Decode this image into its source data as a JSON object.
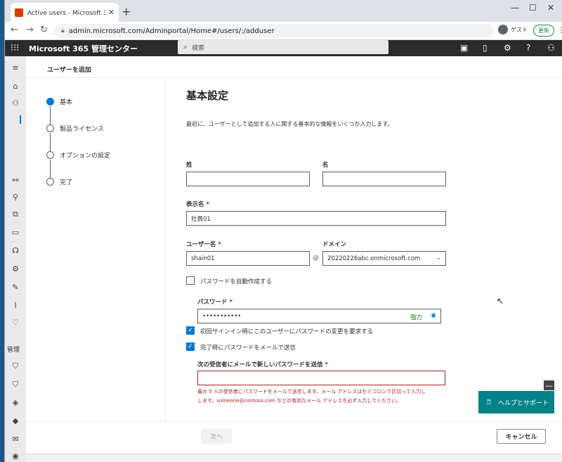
{
  "browser": {
    "tab_title": "Active users - Microsoft 365 管理",
    "new_tab": "+",
    "minimize": "—",
    "maximize": "☐",
    "close": "✕",
    "url": "admin.microsoft.com/Adminportal/Home#/users/:/adduser",
    "guest_label": "ゲスト",
    "update_label": "更新"
  },
  "header": {
    "brand": "Microsoft 365 管理センター",
    "search_placeholder": "検索"
  },
  "rail": {
    "section_label": "管理"
  },
  "panel": {
    "title": "ユーザーを追加"
  },
  "steps": [
    {
      "label": "基本",
      "active": true
    },
    {
      "label": "製品ライセンス",
      "active": false
    },
    {
      "label": "オプションの設定",
      "active": false
    },
    {
      "label": "完了",
      "active": false
    }
  ],
  "form": {
    "heading": "基本設定",
    "description": "最初に、ユーザーとして追加する人に関する基本的な情報をいくつか入力します。",
    "last_name_label": "姓",
    "last_name_value": "",
    "first_name_label": "名",
    "first_name_value": "",
    "display_name_label": "表示名",
    "display_name_value": "社員01",
    "username_label": "ユーザー名",
    "username_value": "shain01",
    "at": "@",
    "domain_label": "ドメイン",
    "domain_value": "20220226abc.onmicrosoft.com",
    "required_mark": "*",
    "auto_password_label": "パスワードを自動作成する",
    "auto_password_checked": false,
    "password_label": "パスワード",
    "password_value": "•••••••••••",
    "password_strength": "強力",
    "require_change_label": "初回サインイン時にこのユーザーにパスワードの変更を要求する",
    "require_change_checked": true,
    "send_email_label": "完了時にパスワードをメールで送信",
    "send_email_checked": true,
    "recipients_label": "次の受信者にメールで新しいパスワードを送信",
    "recipients_value": "",
    "error_line1": "最大 5 人の受信者にパスワードをメールで送信します。メール アドレスはセミコロンで区切って入力し",
    "error_line2": "します。someone@contoso.com などの有効なメール アドレスを必ず入力してください。"
  },
  "footer": {
    "next_label": "次へ",
    "cancel_label": "キャンセル"
  },
  "help": {
    "label": "ヘルプとサポート"
  }
}
